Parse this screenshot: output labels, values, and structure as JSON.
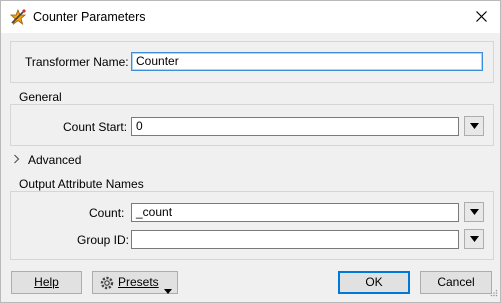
{
  "window": {
    "title": "Counter Parameters"
  },
  "name_group": {
    "label": "Transformer Name:",
    "value": "Counter"
  },
  "general": {
    "legend": "General",
    "count_start": {
      "label": "Count Start:",
      "value": "0"
    }
  },
  "advanced": {
    "label": "Advanced"
  },
  "output": {
    "legend": "Output Attribute Names",
    "count": {
      "label": "Count:",
      "value": "_count"
    },
    "group_id": {
      "label": "Group ID:",
      "value": ""
    }
  },
  "buttons": {
    "help": "Help",
    "presets": "Presets",
    "ok": "OK",
    "cancel": "Cancel"
  },
  "colors": {
    "focus_border": "#3c8fd8",
    "default_button": "#0078d7"
  }
}
